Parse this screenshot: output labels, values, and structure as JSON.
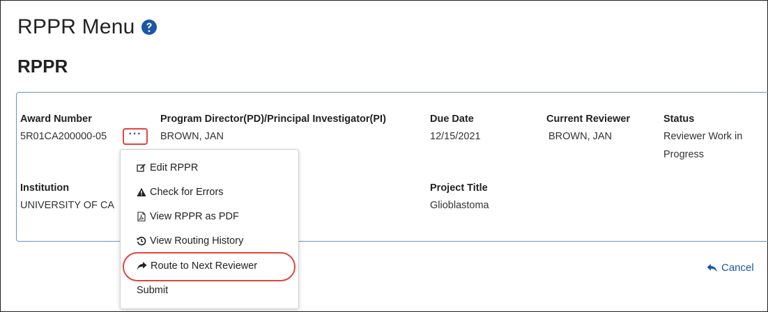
{
  "page": {
    "title": "RPPR Menu",
    "section_title": "RPPR"
  },
  "award": {
    "award_number_label": "Award Number",
    "award_number": "5R01CA200000-05",
    "pd_pi_label": "Program Director(PD)/Principal Investigator(PI)",
    "pd_pi": "BROWN, JAN",
    "due_date_label": "Due Date",
    "due_date": "12/15/2021",
    "current_reviewer_label": "Current Reviewer",
    "current_reviewer": "BROWN, JAN",
    "status_label": "Status",
    "status_line1": "Reviewer Work in",
    "status_line2": "Progress",
    "institution_label": "Institution",
    "institution": "UNIVERSITY OF CA",
    "project_title_label": "Project Title",
    "project_title": "Glioblastoma"
  },
  "more_button": {
    "label": "···"
  },
  "menu": {
    "items": [
      {
        "label": "Edit RPPR",
        "icon": "edit-icon"
      },
      {
        "label": "Check for Errors",
        "icon": "warning-icon"
      },
      {
        "label": "View RPPR as PDF",
        "icon": "pdf-icon"
      },
      {
        "label": "View Routing History",
        "icon": "history-icon"
      },
      {
        "label": "Route to Next Reviewer",
        "icon": "share-arrow-icon"
      },
      {
        "label": "Submit",
        "icon": ""
      }
    ]
  },
  "cancel": {
    "label": "Cancel",
    "icon": "reply-arrow-icon"
  },
  "colors": {
    "highlight": "#e0443e",
    "link": "#1a56a8",
    "box_border": "#6c8fc9"
  }
}
